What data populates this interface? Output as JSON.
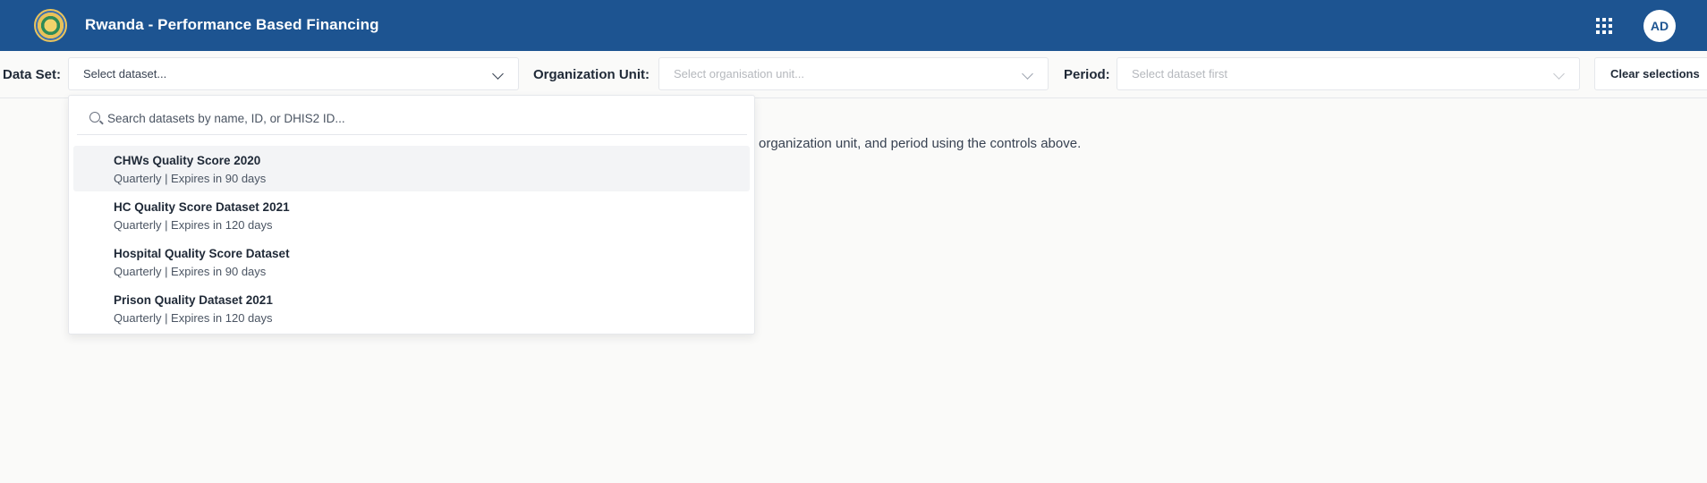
{
  "header": {
    "title": "Rwanda - Performance Based Financing",
    "logo_icon": "rwanda-coat-of-arms",
    "apps_icon": "apps-grid-icon",
    "avatar_initials": "AD",
    "bg_color": "#1d5491"
  },
  "filters": {
    "dataset": {
      "label": "Data Set:",
      "placeholder": "Select dataset..."
    },
    "org_unit": {
      "label": "Organization Unit:",
      "placeholder": "Select organisation unit..."
    },
    "period": {
      "label": "Period:",
      "placeholder": "Select dataset first"
    },
    "clear_label": "Clear selections"
  },
  "main": {
    "message_visible": "organization unit, and period using the controls above."
  },
  "dropdown": {
    "search_placeholder": "Search datasets by name, ID, or DHIS2 ID...",
    "options": [
      {
        "name": "CHWs Quality Score 2020",
        "meta": "Quarterly | Expires in 90 days"
      },
      {
        "name": "HC Quality Score Dataset 2021",
        "meta": "Quarterly | Expires in 120 days"
      },
      {
        "name": "Hospital Quality Score Dataset",
        "meta": "Quarterly | Expires in 90 days"
      },
      {
        "name": "Prison Quality Dataset 2021",
        "meta": "Quarterly | Expires in 120 days"
      }
    ],
    "active_option": 0
  }
}
